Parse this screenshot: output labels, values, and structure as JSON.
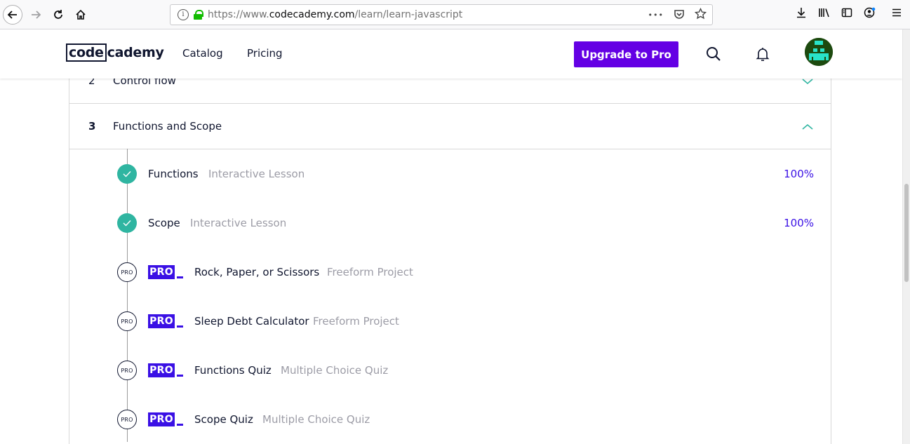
{
  "browser": {
    "url_prefix": "https://www.",
    "url_host": "codecademy.com",
    "url_path": "/learn/learn-javascript",
    "page_actions_label": "•••"
  },
  "header": {
    "logo_boxed": "code",
    "logo_rest": "cademy",
    "nav": [
      "Catalog",
      "Pricing"
    ],
    "upgrade_label": "Upgrade to Pro"
  },
  "modules": [
    {
      "number": "2",
      "title": "Control flow",
      "expanded": false
    },
    {
      "number": "3",
      "title": "Functions and Scope",
      "expanded": true
    }
  ],
  "lessons": [
    {
      "name": "Functions",
      "type": "Interactive Lesson",
      "progress": "100%",
      "status": "complete"
    },
    {
      "name": "Scope",
      "type": "Interactive Lesson",
      "progress": "100%",
      "status": "complete"
    },
    {
      "name": "Rock, Paper, or Scissors",
      "type": "Freeform Project",
      "status": "pro",
      "badge": "PRO",
      "circle": "PRO"
    },
    {
      "name": "Sleep Debt Calculator",
      "type": "Freeform Project",
      "status": "pro",
      "badge": "PRO",
      "circle": "PRO"
    },
    {
      "name": "Functions Quiz",
      "type": "Multiple Choice Quiz",
      "status": "pro",
      "badge": "PRO",
      "circle": "PRO"
    },
    {
      "name": "Scope Quiz",
      "type": "Multiple Choice Quiz",
      "status": "pro",
      "badge": "PRO",
      "circle": "PRO"
    }
  ],
  "colors": {
    "brand_purple": "#6400e4",
    "pro_blue": "#3a10e5",
    "complete_teal": "#2fb5a1",
    "text_navy": "#10162f",
    "muted_gray": "#9c9ca6"
  }
}
